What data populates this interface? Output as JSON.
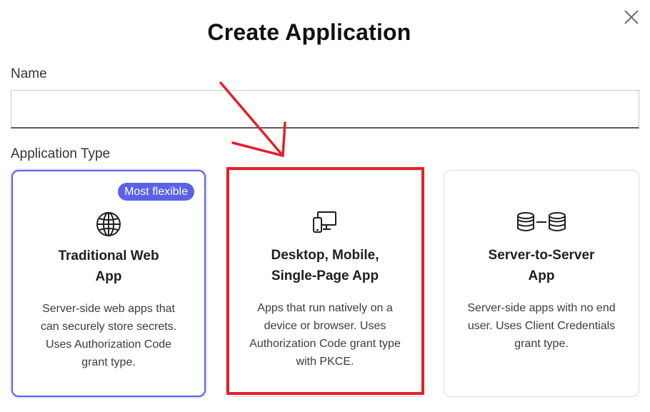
{
  "dialog": {
    "title": "Create Application",
    "close_icon": "close-icon"
  },
  "name_field": {
    "label": "Name",
    "value": "",
    "placeholder": ""
  },
  "application_type": {
    "label": "Application Type",
    "options": [
      {
        "id": "regular_web",
        "title": "Traditional Web App",
        "title_line1": "Traditional Web",
        "title_line2": "App",
        "description": "Server-side web apps that can securely store secrets. Uses Authorization Code grant type.",
        "badge": "Most flexible",
        "icon": "globe-icon",
        "selected": true
      },
      {
        "id": "spa",
        "title": "Desktop, Mobile, Single-Page App",
        "title_line1": "Desktop, Mobile,",
        "title_line2": "Single-Page App",
        "description": "Apps that run natively on a device or browser. Uses Authorization Code grant type with PKCE.",
        "icon": "devices-icon",
        "selected": false
      },
      {
        "id": "m2m",
        "title": "Server-to-Server App",
        "title_line1": "Server-to-Server",
        "title_line2": "App",
        "description": "Server-side apps with no end user. Uses Client Credentials grant type.",
        "icon": "database-link-icon",
        "selected": false
      }
    ]
  },
  "annotation": {
    "color": "#e3202a",
    "arrow_icon": "annotation-arrow",
    "highlight_target": "spa"
  },
  "colors": {
    "accent": "#5b61e8",
    "annotation_red": "#e3202a"
  }
}
